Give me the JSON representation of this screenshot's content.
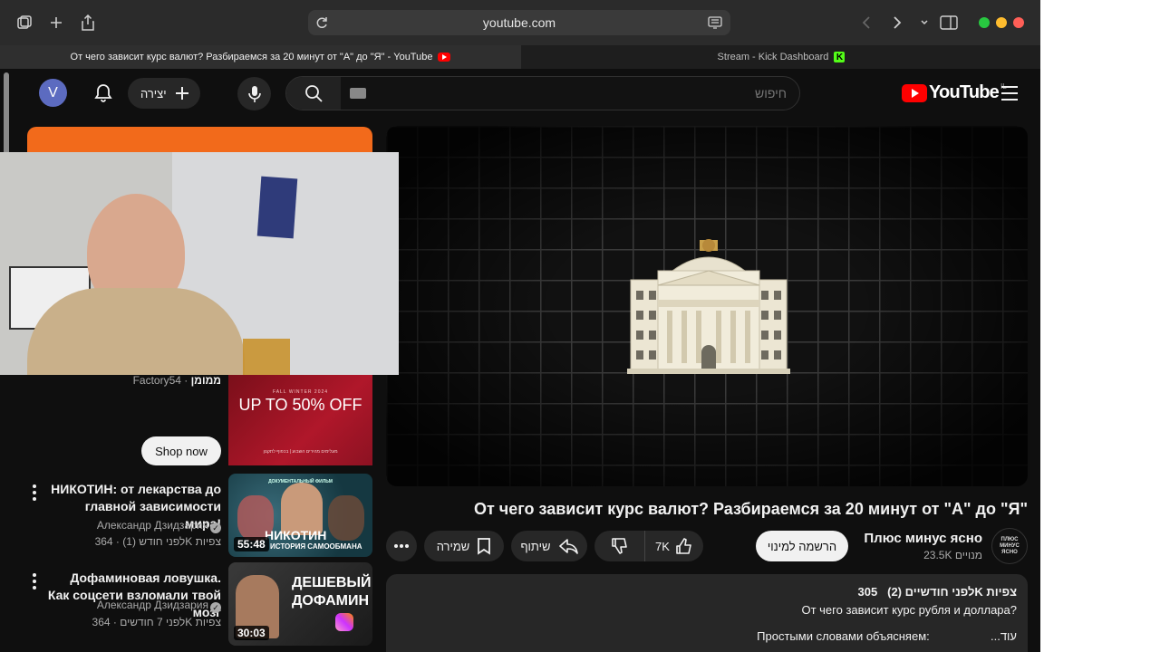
{
  "browser": {
    "url": "youtube.com",
    "tabs": [
      {
        "title": "От чего зависит курс валют? Разбираемся за 20 минут от \"А\" до \"Я\" - YouTube",
        "active": true
      },
      {
        "title": "Stream - Kick Dashboard",
        "active": false
      }
    ]
  },
  "header": {
    "avatar_letter": "V",
    "create_label": "יצירה",
    "search_placeholder": "חיפוש",
    "logo_text": "YouTube",
    "logo_region": "IL"
  },
  "video": {
    "title": "От чего зависит курс валют? Разбираемся за 20 минут от \"А\" до \"Я\"",
    "channel_name": "Плюс минус ясно",
    "channel_subs": "23.5K מנויים",
    "channel_avatar_lines": [
      "ПЛЮС МИНУС",
      "ЯСНО"
    ],
    "subscribe_label": "הרשמה למינוי",
    "like_count": "7K",
    "share_label": "שיתוף",
    "save_label": "שמירה"
  },
  "description": {
    "meta_views": "305K צפיות",
    "meta_age": "לפני חודשיים (2)",
    "line1": "От чего зависит курс рубля и доллара?",
    "line2": "Простыми словами объясняем:",
    "more": "...עוד"
  },
  "sidebar": {
    "sponsor_label": "ממומן",
    "sponsor_name": "Factory54",
    "shop_now": "Shop now",
    "ad_season": "FALL WINTER 2024",
    "ad_headline": "UP TO 50% OFF",
    "ad_footer": "מעלימים מהירים השבוע | בכפוף לתקנון",
    "recommendations": [
      {
        "title": "НИКОТИН: от лекарства до главной зависимости мира!",
        "author": "Александр Дзидзария",
        "views": "364K צפיות",
        "age": "לפני חודש (1)",
        "duration": "55:48",
        "thumb_kicker": "ДОКУМЕНТАЛЬНЫЙ ФИЛЬМ",
        "thumb_big": "НИКОТИН",
        "thumb_sub": "ИСТОРИЯ САМООБМАНА"
      },
      {
        "title": "Дофаминовая ловушка. Как соцсети взломали твой мозг",
        "author": "Александр Дзидзария",
        "views": "364K צפיות",
        "age": "לפני 7 חודשים",
        "duration": "30:03",
        "thumb_line1": "ДЕШЕВЫЙ",
        "thumb_line2": "ДОФАМИН"
      }
    ]
  },
  "colors": {
    "accent": "#ff0000",
    "background": "#0f0f0f",
    "surface": "#272727",
    "ad_orange": "#f26a1b",
    "kick_green": "#53fc18"
  }
}
